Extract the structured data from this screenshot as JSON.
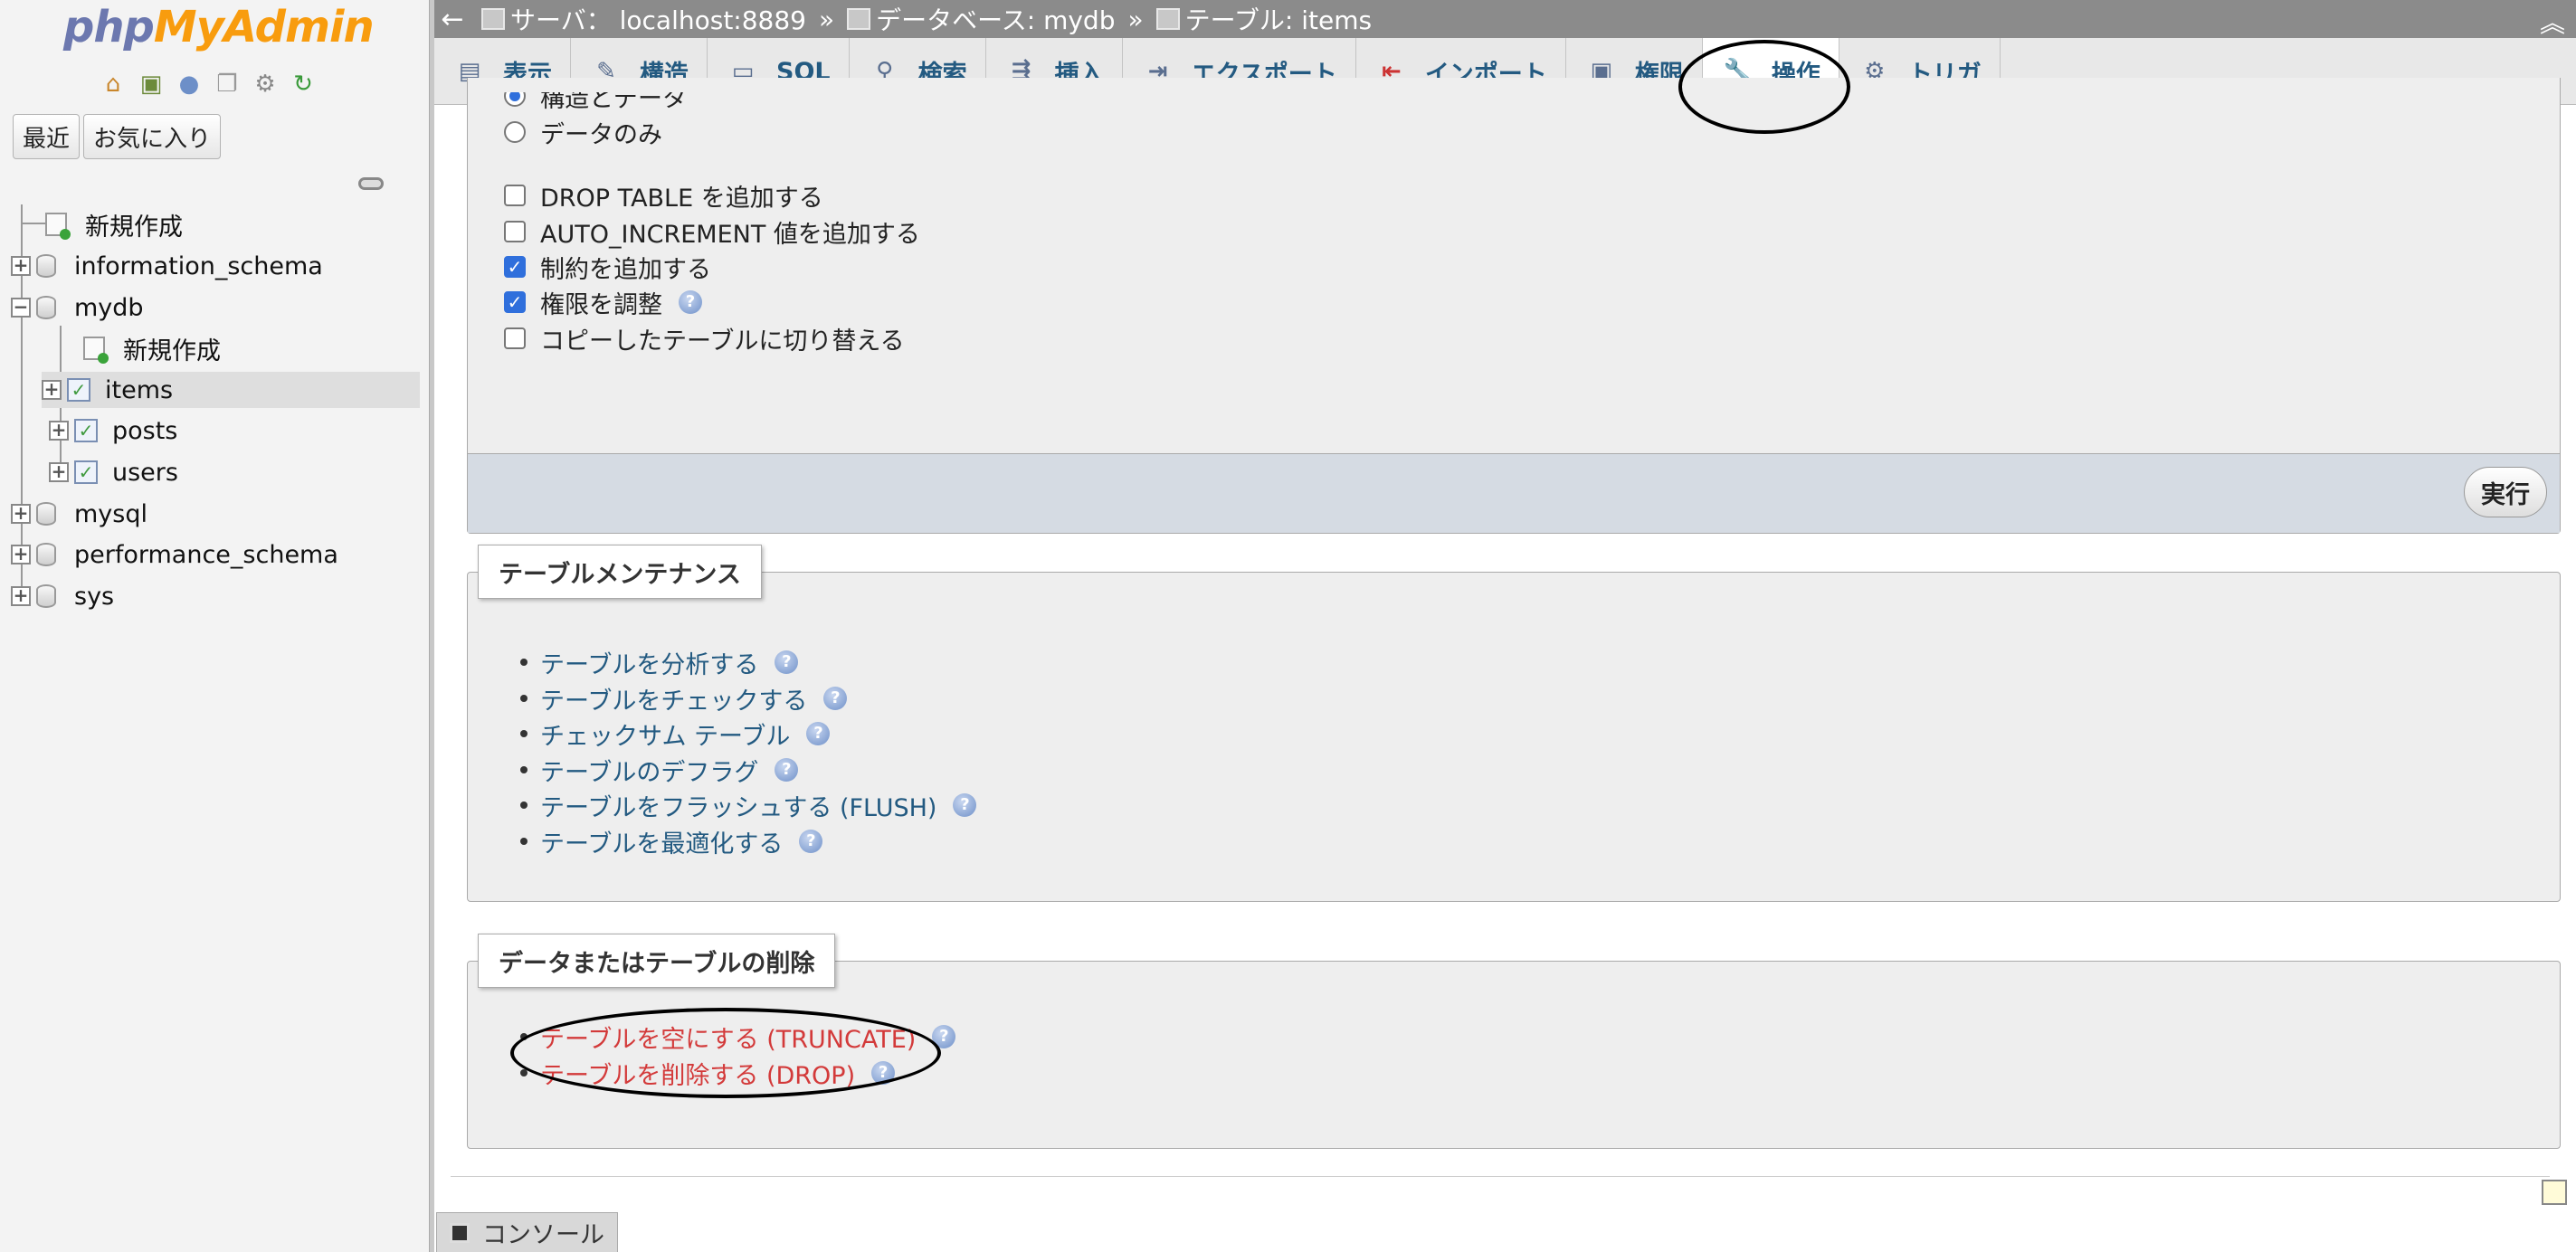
{
  "logo": {
    "php": "php",
    "myadmin": "MyAdmin"
  },
  "sidebar": {
    "nav_icons": [
      "home-icon",
      "logout-icon",
      "help-icon",
      "docs-icon",
      "settings-icon",
      "reload-icon"
    ],
    "recent_label": "最近",
    "favorites_label": "お気に入り",
    "tree": [
      {
        "label": "新規作成",
        "kind": "new"
      },
      {
        "label": "information_schema",
        "kind": "db"
      },
      {
        "label": "mydb",
        "kind": "db",
        "expanded": true
      },
      {
        "label": "新規作成",
        "kind": "new-table"
      },
      {
        "label": "items",
        "kind": "table",
        "active": true
      },
      {
        "label": "posts",
        "kind": "table"
      },
      {
        "label": "users",
        "kind": "table"
      },
      {
        "label": "mysql",
        "kind": "db"
      },
      {
        "label": "performance_schema",
        "kind": "db"
      },
      {
        "label": "sys",
        "kind": "db"
      }
    ]
  },
  "breadcrumb": {
    "back": "←",
    "server": "サーバ： localhost:8889",
    "database": "データベース: mydb",
    "table": "テーブル: items",
    "separator": "»"
  },
  "tabs": [
    {
      "label": "表示",
      "icon": "browse-icon"
    },
    {
      "label": "構造",
      "icon": "structure-icon"
    },
    {
      "label": "SQL",
      "icon": "sql-icon"
    },
    {
      "label": "検索",
      "icon": "search-icon"
    },
    {
      "label": "挿入",
      "icon": "insert-icon"
    },
    {
      "label": "エクスポート",
      "icon": "export-icon"
    },
    {
      "label": "インポート",
      "icon": "import-icon"
    },
    {
      "label": "権限",
      "icon": "privileges-icon"
    },
    {
      "label": "操作",
      "icon": "wrench-icon",
      "active": true
    },
    {
      "label": "トリガ",
      "icon": "triggers-icon"
    }
  ],
  "copy_options": {
    "radio_structure_data": "構造とデータ",
    "radio_data_only": "データのみ",
    "checkboxes": [
      {
        "label": "DROP TABLE を追加する",
        "checked": false
      },
      {
        "label": "AUTO_INCREMENT 値を追加する",
        "checked": false
      },
      {
        "label": "制約を追加する",
        "checked": true
      },
      {
        "label": "権限を調整",
        "checked": true,
        "help": true
      },
      {
        "label": "コピーしたテーブルに切り替える",
        "checked": false
      }
    ],
    "execute_label": "実行"
  },
  "maintenance": {
    "legend": "テーブルメンテナンス",
    "items": [
      "テーブルを分析する",
      "テーブルをチェックする",
      "チェックサム テーブル",
      "テーブルのデフラグ",
      "テーブルをフラッシュする (FLUSH)",
      "テーブルを最適化する"
    ]
  },
  "delete_section": {
    "legend": "データまたはテーブルの削除",
    "items": [
      "テーブルを空にする (TRUNCATE)",
      "テーブルを削除する (DROP)"
    ]
  },
  "console": {
    "label": "コンソール"
  },
  "colors": {
    "link": "#235a81",
    "danger": "#d33a3a",
    "topbar": "#8b8b8b",
    "logo_php": "#6c78af",
    "logo_myadmin": "#f89c0e"
  }
}
